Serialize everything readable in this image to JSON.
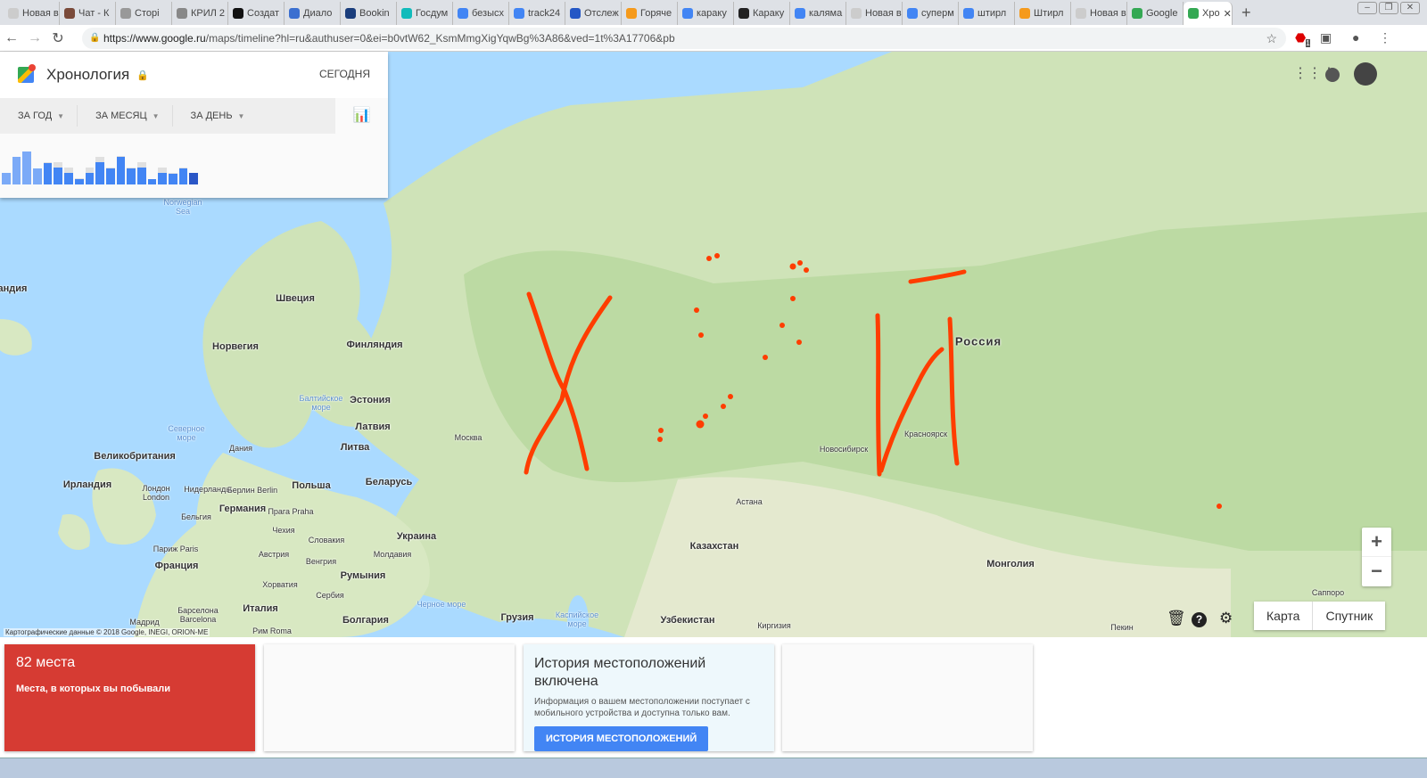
{
  "browser": {
    "tabs": [
      "Новая вкла",
      "Чат - К",
      "Сторі",
      "КРИЛ 2",
      "Создат",
      "Диало",
      "Bookin",
      "Госдум",
      "безысх",
      "track24",
      "Отслеж",
      "Горяче",
      "караку",
      "Караку",
      "каляма",
      "Новая вкла",
      "суперм",
      "штирл",
      "Штирл",
      "Новая вкла",
      "Google",
      "Хро"
    ],
    "active_tab": "Хро",
    "url_host": "https://www.google.ru",
    "url_path": "/maps/timeline?hl=ru&authuser=0&ei=b0vtW62_KsmMmgXigYqwBg%3A86&ved=1t%3A17706&pb",
    "ext_badge": "1"
  },
  "panel": {
    "title": "Хронология",
    "today": "СЕГОДНЯ",
    "filters": [
      "ЗА ГОД",
      "ЗА МЕСЯЦ",
      "ЗА ДЕНЬ"
    ],
    "histogram": [
      {
        "value": 37,
        "total": 37,
        "color": "#7baaf7"
      },
      {
        "value": 92,
        "total": 92,
        "color": "#7baaf7"
      },
      {
        "value": 109,
        "total": 109,
        "color": "#7baaf7"
      },
      {
        "value": 54,
        "total": 54,
        "color": "#7baaf7"
      },
      {
        "value": 70,
        "total": 73,
        "color": "#4285f4"
      },
      {
        "value": 55,
        "total": 73,
        "color": "#4285f4"
      },
      {
        "value": 38,
        "total": 55,
        "color": "#4285f4"
      },
      {
        "value": 17,
        "total": 20,
        "color": "#4285f4"
      },
      {
        "value": 38,
        "total": 55,
        "color": "#4285f4"
      },
      {
        "value": 73,
        "total": 92,
        "color": "#4285f4"
      },
      {
        "value": 54,
        "total": 57,
        "color": "#4285f4"
      },
      {
        "value": 92,
        "total": 95,
        "color": "#4285f4"
      },
      {
        "value": 54,
        "total": 57,
        "color": "#4285f4"
      },
      {
        "value": 55,
        "total": 73,
        "color": "#4285f4"
      },
      {
        "value": 17,
        "total": 17,
        "color": "#4285f4"
      },
      {
        "value": 38,
        "total": 55,
        "color": "#4285f4"
      },
      {
        "value": 35,
        "total": 37,
        "color": "#4285f4"
      },
      {
        "value": 52,
        "total": 57,
        "color": "#4285f4"
      },
      {
        "value": 37,
        "total": 37,
        "color": "#2a56c6"
      }
    ]
  },
  "map": {
    "labels": {
      "norwegian_sea": "Norwegian Sea",
      "iceland": "андия",
      "sweden": "Швеция",
      "norway": "Норвегия",
      "finland": "Финляндия",
      "estonia": "Эстония",
      "latvia": "Латвия",
      "lithuania": "Литва",
      "baltic": "Балтийское море",
      "north_sea": "Северное море",
      "denmark": "Дания",
      "uk": "Великобритания",
      "ireland": "Ирландия",
      "london": "Лондон London",
      "netherlands": "Нидерланды",
      "berlin": "Берлин Berlin",
      "poland": "Польша",
      "belarus": "Беларусь",
      "germany": "Германия",
      "belgium": "Бельгия",
      "prague": "Прага Praha",
      "czech": "Чехия",
      "paris": "Париж Paris",
      "slovakia": "Словакия",
      "ukraine": "Украина",
      "austria": "Австрия",
      "france": "Франция",
      "hungary": "Венгрия",
      "moldova": "Молдавия",
      "croatia": "Хорватия",
      "romania": "Румыния",
      "serbia": "Сербия",
      "italy": "Италия",
      "barcelona": "Барселона Barcelona",
      "madrid": "Мадрид",
      "bulgaria": "Болгария",
      "rome": "Рим Roma",
      "black_sea": "Черное море",
      "georgia": "Грузия",
      "caspian": "Каспийское море",
      "uzbekistan": "Узбекистан",
      "kyrgyzstan": "Киргизия",
      "moscow": "Москва",
      "astana": "Астана",
      "kazakhstan": "Казахстан",
      "novosibirsk": "Новосибирск",
      "krasnoyarsk": "Красноярск",
      "russia": "Россия",
      "mongolia": "Монголия",
      "beijing": "Пекин",
      "sapporo": "Саппоро"
    },
    "attribution": "Картографические данные © 2018 Google, INEGI, ORION-ME",
    "map_type": [
      "Карта",
      "Спутник"
    ],
    "zoom_in": "+",
    "zoom_out": "−",
    "path_color": "#ff3d00"
  },
  "cards": {
    "places_count": "82 места",
    "places_text": "Места, в которых вы побывали",
    "history_title": "История местоположений включена",
    "history_text": "Информация о вашем местоположении поступает с мобильного устройства и доступна только вам.",
    "history_button": "ИСТОРИЯ МЕСТОПОЛОЖЕНИЙ"
  }
}
